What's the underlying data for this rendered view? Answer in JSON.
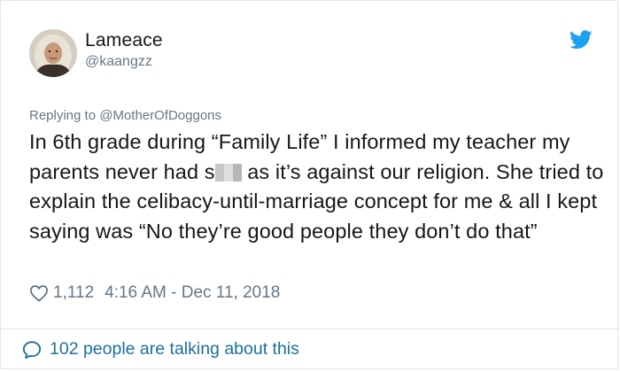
{
  "author": {
    "display_name": "Lameace",
    "handle": "@kaangzz",
    "avatar_icon": "user-avatar-photo"
  },
  "replying_to": "Replying to @MotherOfDoggons",
  "tweet": {
    "text_before_censor": "In 6th grade during “Family Life” I informed my teacher my parents never had s",
    "text_after_censor": " as it’s against our religion. She tried to explain the celibacy-until-marriage concept for me & all I kept saying was “No they’re good people they don’t do that”"
  },
  "meta": {
    "like_icon": "heart-icon",
    "like_count": "1,112",
    "timestamp": "4:16 AM - Dec 11, 2018"
  },
  "footer": {
    "bubble_icon": "comment-bubble-icon",
    "talking_text": "102 people are talking about this"
  },
  "colors": {
    "twitter_blue": "#1da1f2",
    "link_blue": "#1b6f9d",
    "text": "#14171a",
    "muted": "#657786",
    "border": "#e1e8ed"
  }
}
